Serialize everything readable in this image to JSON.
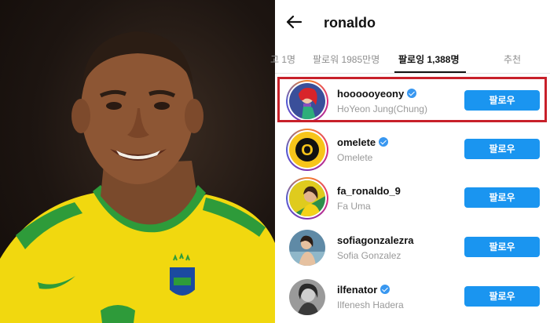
{
  "profile": {
    "username": "ronaldo"
  },
  "tabs": [
    {
      "label": "고 1명"
    },
    {
      "label": "팔로워 1985만명"
    },
    {
      "label": "팔로잉 1,388명",
      "active": true
    },
    {
      "label": "추천"
    }
  ],
  "following": [
    {
      "handle": "hoooooyeony",
      "name": "HoYeon Jung(Chung)",
      "verified": true,
      "button": "팔로우",
      "highlighted": true,
      "avatar": "mermaid-avatar"
    },
    {
      "handle": "omelete",
      "name": "Omelete",
      "verified": true,
      "button": "팔로우",
      "highlighted": false,
      "avatar": "o-logo-avatar"
    },
    {
      "handle": "fa_ronaldo_9",
      "name": "Fa Uma",
      "verified": false,
      "button": "팔로우",
      "highlighted": false,
      "avatar": "fan-avatar"
    },
    {
      "handle": "sofiagonzalezra",
      "name": "Sofia Gonzalez",
      "verified": false,
      "button": "팔로우",
      "highlighted": false,
      "avatar": "sofia-avatar"
    },
    {
      "handle": "ilfenator",
      "name": "Ilfenesh Hadera",
      "verified": true,
      "button": "팔로우",
      "highlighted": false,
      "avatar": "bw-portrait-avatar"
    }
  ],
  "colors": {
    "follow_button": "#1a95f0",
    "verified_badge": "#3897f0",
    "highlight_box": "#c8202a"
  }
}
